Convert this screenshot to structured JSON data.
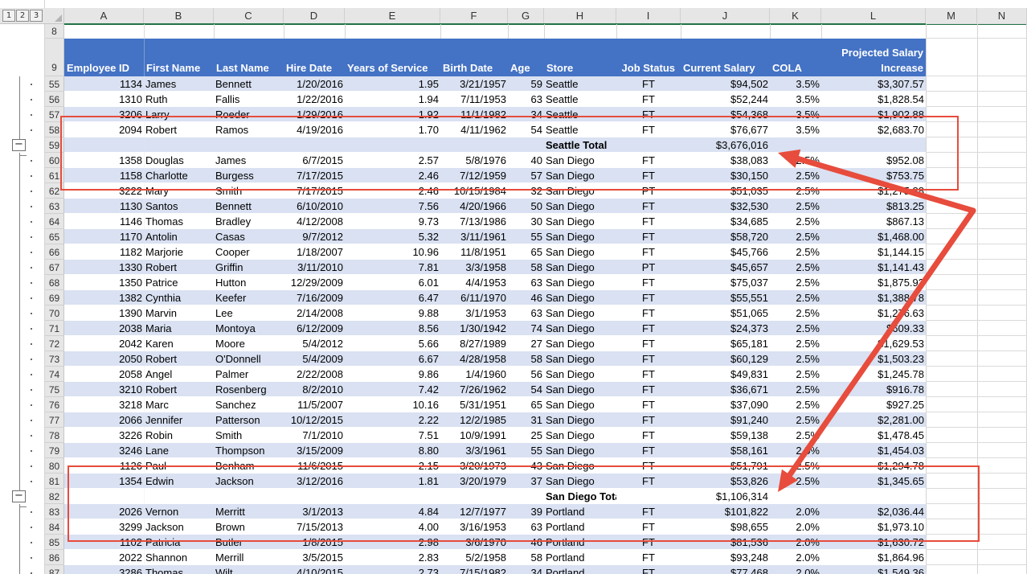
{
  "outline_levels": [
    "1",
    "2",
    "3"
  ],
  "columns": [
    "A",
    "B",
    "C",
    "D",
    "E",
    "F",
    "G",
    "H",
    "I",
    "J",
    "K",
    "L",
    "M",
    "N"
  ],
  "blank_row": "8",
  "header_row": {
    "row": "9",
    "employee_id": "Employee ID",
    "first_name": "First Name",
    "last_name": "Last Name",
    "hire_date": "Hire Date",
    "years_of_service": "Years of Service",
    "birth_date": "Birth Date",
    "age": "Age",
    "store": "Store",
    "job_status": "Job Status",
    "current_salary": "Current Salary",
    "cola": "COLA",
    "projected_line1": "Projected Salary",
    "projected_line2": "Increase"
  },
  "rows": [
    {
      "row": "55",
      "type": "data",
      "id": "1134",
      "first": "James",
      "last": "Bennett",
      "hire": "1/20/2016",
      "yos": "1.95",
      "birth": "3/21/1957",
      "age": "59",
      "store": "Seattle",
      "status": "FT",
      "salary": "$94,502",
      "cola": "3.5%",
      "proj": "$3,307.57"
    },
    {
      "row": "56",
      "type": "data",
      "id": "1310",
      "first": "Ruth",
      "last": "Fallis",
      "hire": "1/22/2016",
      "yos": "1.94",
      "birth": "7/11/1953",
      "age": "63",
      "store": "Seattle",
      "status": "FT",
      "salary": "$52,244",
      "cola": "3.5%",
      "proj": "$1,828.54"
    },
    {
      "row": "57",
      "type": "data",
      "id": "3206",
      "first": "Larry",
      "last": "Roeder",
      "hire": "1/29/2016",
      "yos": "1.92",
      "birth": "11/1/1982",
      "age": "34",
      "store": "Seattle",
      "status": "FT",
      "salary": "$54,368",
      "cola": "3.5%",
      "proj": "$1,902.88"
    },
    {
      "row": "58",
      "type": "data",
      "id": "2094",
      "first": "Robert",
      "last": "Ramos",
      "hire": "4/19/2016",
      "yos": "1.70",
      "birth": "4/11/1962",
      "age": "54",
      "store": "Seattle",
      "status": "FT",
      "salary": "$76,677",
      "cola": "3.5%",
      "proj": "$2,683.70"
    },
    {
      "row": "59",
      "type": "total",
      "label": "Seattle Total",
      "salary": "$3,676,016"
    },
    {
      "row": "60",
      "type": "data",
      "id": "1358",
      "first": "Douglas",
      "last": "James",
      "hire": "6/7/2015",
      "yos": "2.57",
      "birth": "5/8/1976",
      "age": "40",
      "store": "San Diego",
      "status": "FT",
      "salary": "$38,083",
      "cola": "2.5%",
      "proj": "$952.08"
    },
    {
      "row": "61",
      "type": "data",
      "id": "1158",
      "first": "Charlotte",
      "last": "Burgess",
      "hire": "7/17/2015",
      "yos": "2.46",
      "birth": "7/12/1959",
      "age": "57",
      "store": "San Diego",
      "status": "FT",
      "salary": "$30,150",
      "cola": "2.5%",
      "proj": "$753.75"
    },
    {
      "row": "62",
      "type": "data",
      "id": "3222",
      "first": "Mary",
      "last": "Smith",
      "hire": "7/17/2015",
      "yos": "2.46",
      "birth": "10/15/1984",
      "age": "32",
      "store": "San Diego",
      "status": "PT",
      "salary": "$51,035",
      "cola": "2.5%",
      "proj": "$1,275.88"
    },
    {
      "row": "63",
      "type": "data",
      "id": "1130",
      "first": "Santos",
      "last": "Bennett",
      "hire": "6/10/2010",
      "yos": "7.56",
      "birth": "4/20/1966",
      "age": "50",
      "store": "San Diego",
      "status": "FT",
      "salary": "$32,530",
      "cola": "2.5%",
      "proj": "$813.25"
    },
    {
      "row": "64",
      "type": "data",
      "id": "1146",
      "first": "Thomas",
      "last": "Bradley",
      "hire": "4/12/2008",
      "yos": "9.73",
      "birth": "7/13/1986",
      "age": "30",
      "store": "San Diego",
      "status": "FT",
      "salary": "$34,685",
      "cola": "2.5%",
      "proj": "$867.13"
    },
    {
      "row": "65",
      "type": "data",
      "id": "1170",
      "first": "Antolin",
      "last": "Casas",
      "hire": "9/7/2012",
      "yos": "5.32",
      "birth": "3/11/1961",
      "age": "55",
      "store": "San Diego",
      "status": "FT",
      "salary": "$58,720",
      "cola": "2.5%",
      "proj": "$1,468.00"
    },
    {
      "row": "66",
      "type": "data",
      "id": "1182",
      "first": "Marjorie",
      "last": "Cooper",
      "hire": "1/18/2007",
      "yos": "10.96",
      "birth": "11/8/1951",
      "age": "65",
      "store": "San Diego",
      "status": "FT",
      "salary": "$45,766",
      "cola": "2.5%",
      "proj": "$1,144.15"
    },
    {
      "row": "67",
      "type": "data",
      "id": "1330",
      "first": "Robert",
      "last": "Griffin",
      "hire": "3/11/2010",
      "yos": "7.81",
      "birth": "3/3/1958",
      "age": "58",
      "store": "San Diego",
      "status": "PT",
      "salary": "$45,657",
      "cola": "2.5%",
      "proj": "$1,141.43"
    },
    {
      "row": "68",
      "type": "data",
      "id": "1350",
      "first": "Patrice",
      "last": "Hutton",
      "hire": "12/29/2009",
      "yos": "6.01",
      "birth": "4/4/1953",
      "age": "63",
      "store": "San Diego",
      "status": "FT",
      "salary": "$75,037",
      "cola": "2.5%",
      "proj": "$1,875.93"
    },
    {
      "row": "69",
      "type": "data",
      "id": "1382",
      "first": "Cynthia",
      "last": "Keefer",
      "hire": "7/16/2009",
      "yos": "6.47",
      "birth": "6/11/1970",
      "age": "46",
      "store": "San Diego",
      "status": "FT",
      "salary": "$55,551",
      "cola": "2.5%",
      "proj": "$1,388.78"
    },
    {
      "row": "70",
      "type": "data",
      "id": "1390",
      "first": "Marvin",
      "last": "Lee",
      "hire": "2/14/2008",
      "yos": "9.88",
      "birth": "3/1/1953",
      "age": "63",
      "store": "San Diego",
      "status": "FT",
      "salary": "$51,065",
      "cola": "2.5%",
      "proj": "$1,276.63"
    },
    {
      "row": "71",
      "type": "data",
      "id": "2038",
      "first": "Maria",
      "last": "Montoya",
      "hire": "6/12/2009",
      "yos": "8.56",
      "birth": "1/30/1942",
      "age": "74",
      "store": "San Diego",
      "status": "FT",
      "salary": "$24,373",
      "cola": "2.5%",
      "proj": "$609.33"
    },
    {
      "row": "72",
      "type": "data",
      "id": "2042",
      "first": "Karen",
      "last": "Moore",
      "hire": "5/4/2012",
      "yos": "5.66",
      "birth": "8/27/1989",
      "age": "27",
      "store": "San Diego",
      "status": "FT",
      "salary": "$65,181",
      "cola": "2.5%",
      "proj": "$1,629.53"
    },
    {
      "row": "73",
      "type": "data",
      "id": "2050",
      "first": "Robert",
      "last": "O'Donnell",
      "hire": "5/4/2009",
      "yos": "6.67",
      "birth": "4/28/1958",
      "age": "58",
      "store": "San Diego",
      "status": "FT",
      "salary": "$60,129",
      "cola": "2.5%",
      "proj": "$1,503.23"
    },
    {
      "row": "74",
      "type": "data",
      "id": "2058",
      "first": "Angel",
      "last": "Palmer",
      "hire": "2/22/2008",
      "yos": "9.86",
      "birth": "1/4/1960",
      "age": "56",
      "store": "San Diego",
      "status": "FT",
      "salary": "$49,831",
      "cola": "2.5%",
      "proj": "$1,245.78"
    },
    {
      "row": "75",
      "type": "data",
      "id": "3210",
      "first": "Robert",
      "last": "Rosenberg",
      "hire": "8/2/2010",
      "yos": "7.42",
      "birth": "7/26/1962",
      "age": "54",
      "store": "San Diego",
      "status": "FT",
      "salary": "$36,671",
      "cola": "2.5%",
      "proj": "$916.78"
    },
    {
      "row": "76",
      "type": "data",
      "id": "3218",
      "first": "Marc",
      "last": "Sanchez",
      "hire": "11/5/2007",
      "yos": "10.16",
      "birth": "5/31/1951",
      "age": "65",
      "store": "San Diego",
      "status": "FT",
      "salary": "$37,090",
      "cola": "2.5%",
      "proj": "$927.25"
    },
    {
      "row": "77",
      "type": "data",
      "id": "2066",
      "first": "Jennifer",
      "last": "Patterson",
      "hire": "10/12/2015",
      "yos": "2.22",
      "birth": "12/2/1985",
      "age": "31",
      "store": "San Diego",
      "status": "FT",
      "salary": "$91,240",
      "cola": "2.5%",
      "proj": "$2,281.00"
    },
    {
      "row": "78",
      "type": "data",
      "id": "3226",
      "first": "Robin",
      "last": "Smith",
      "hire": "7/1/2010",
      "yos": "7.51",
      "birth": "10/9/1991",
      "age": "25",
      "store": "San Diego",
      "status": "FT",
      "salary": "$59,138",
      "cola": "2.5%",
      "proj": "$1,478.45"
    },
    {
      "row": "79",
      "type": "data",
      "id": "3246",
      "first": "Lane",
      "last": "Thompson",
      "hire": "3/15/2009",
      "yos": "8.80",
      "birth": "3/3/1961",
      "age": "55",
      "store": "San Diego",
      "status": "FT",
      "salary": "$58,161",
      "cola": "2.5%",
      "proj": "$1,454.03"
    },
    {
      "row": "80",
      "type": "data",
      "id": "1126",
      "first": "Paul",
      "last": "Benham",
      "hire": "11/6/2015",
      "yos": "2.15",
      "birth": "3/20/1973",
      "age": "43",
      "store": "San Diego",
      "status": "FT",
      "salary": "$51,791",
      "cola": "2.5%",
      "proj": "$1,294.78"
    },
    {
      "row": "81",
      "type": "data",
      "id": "1354",
      "first": "Edwin",
      "last": "Jackson",
      "hire": "3/12/2016",
      "yos": "1.81",
      "birth": "3/20/1979",
      "age": "37",
      "store": "San Diego",
      "status": "FT",
      "salary": "$53,826",
      "cola": "2.5%",
      "proj": "$1,345.65"
    },
    {
      "row": "82",
      "type": "total",
      "label": "San Diego Total",
      "salary": "$1,106,314"
    },
    {
      "row": "83",
      "type": "data",
      "id": "2026",
      "first": "Vernon",
      "last": "Merritt",
      "hire": "3/1/2013",
      "yos": "4.84",
      "birth": "12/7/1977",
      "age": "39",
      "store": "Portland",
      "status": "FT",
      "salary": "$101,822",
      "cola": "2.0%",
      "proj": "$2,036.44"
    },
    {
      "row": "84",
      "type": "data",
      "id": "3299",
      "first": "Jackson",
      "last": "Brown",
      "hire": "7/15/2013",
      "yos": "4.00",
      "birth": "3/16/1953",
      "age": "63",
      "store": "Portland",
      "status": "FT",
      "salary": "$98,655",
      "cola": "2.0%",
      "proj": "$1,973.10"
    },
    {
      "row": "85",
      "type": "data",
      "id": "1102",
      "first": "Patricia",
      "last": "Butler",
      "hire": "1/8/2015",
      "yos": "2.98",
      "birth": "3/6/1970",
      "age": "46",
      "store": "Portland",
      "status": "FT",
      "salary": "$81,536",
      "cola": "2.0%",
      "proj": "$1,630.72"
    },
    {
      "row": "86",
      "type": "data",
      "id": "2022",
      "first": "Shannon",
      "last": "Merrill",
      "hire": "3/5/2015",
      "yos": "2.83",
      "birth": "5/2/1958",
      "age": "58",
      "store": "Portland",
      "status": "FT",
      "salary": "$93,248",
      "cola": "2.0%",
      "proj": "$1,864.96"
    },
    {
      "row": "87",
      "type": "data",
      "id": "3286",
      "first": "Thomas",
      "last": "Wilt",
      "hire": "4/10/2015",
      "yos": "2.73",
      "birth": "7/15/1982",
      "age": "34",
      "store": "Portland",
      "status": "FT",
      "salary": "$77,468",
      "cola": "2.0%",
      "proj": "$1,549.36"
    }
  ],
  "colors": {
    "header_fill": "#4472c4",
    "band_fill": "#d9e1f2",
    "annotation_red": "#e74c3c",
    "selection_green": "#217346"
  },
  "icons": [
    "outline-collapse-icon",
    "select-all-corner-icon"
  ]
}
